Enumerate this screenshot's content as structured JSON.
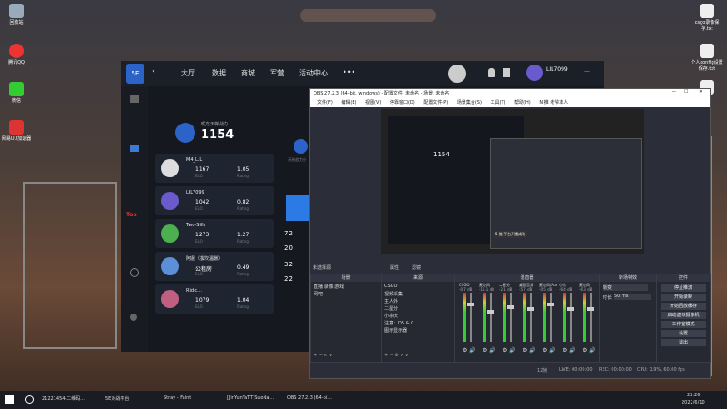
{
  "desktop": {
    "left_icons": [
      {
        "label": "回收站",
        "icon": "recycle-bin-icon",
        "color": "#9ad"
      },
      {
        "label": "腾讯QQ",
        "icon": "qq-icon",
        "color": "#e33"
      },
      {
        "label": "微信",
        "icon": "wechat-icon",
        "color": "#3c3"
      },
      {
        "label": "网易UU加速器",
        "icon": "uu-icon",
        "color": "#d33"
      }
    ],
    "right_icons": [
      {
        "label": "csgo录像保存.txt",
        "icon": "text-file-icon"
      },
      {
        "label": "个人config设置保存.txt",
        "icon": "text-file-icon"
      },
      {
        "label": "",
        "icon": "text-file-icon"
      }
    ]
  },
  "game": {
    "logo": "5E",
    "nav": [
      "大厅",
      "数据",
      "商城",
      "军营",
      "活动中心",
      "•••"
    ],
    "user": "LIL7099",
    "side_label": "Top",
    "highlight": {
      "title": "昵方天梯战力",
      "value": "1154"
    },
    "mid_label": "天梯战力分",
    "players": [
      {
        "name": "M4_L.L",
        "v1": "1167",
        "v2": "1.05",
        "s1": "ELO",
        "s2": "Rating"
      },
      {
        "name": "LIL7099",
        "v1": "1042",
        "v2": "0.82",
        "s1": "ELO",
        "s2": "Rating"
      },
      {
        "name": "Two-Silly",
        "v1": "1273",
        "v2": "1.27",
        "s1": "ELO",
        "s2": "Rating"
      },
      {
        "name": "阿晨（拔坎温酬）",
        "v1": "公租房",
        "v2": "0.49",
        "s1": "ELO",
        "s2": "Rating"
      },
      {
        "name": "Ridic...",
        "v1": "1079",
        "v2": "1.04",
        "s1": "ELO",
        "s2": "Rating"
      }
    ],
    "right_numbers": [
      "72",
      "20",
      "32",
      "22"
    ]
  },
  "obs": {
    "title": "OBS 27.2.3 (64-bit, windows) - 配置文件: 未命名 - 场景: 未命名",
    "menu": [
      "文件(F)",
      "编辑(E)",
      "视图(V)",
      "停靠窗口(D)",
      "配置文件(P)",
      "场景集合(S)",
      "工具(T)",
      "帮助(H)",
      "N 推 老爷本人"
    ],
    "preview_text": "5 推 平台开播成功",
    "preview_score": "1154",
    "no_source": "未选择源",
    "props_btn": "属性",
    "filter_btn": "滤镜",
    "scenes": {
      "header": "场景",
      "items": [
        "直播 录像 游戏",
        "网吧"
      ]
    },
    "sources": {
      "header": "来源",
      "items": [
        "CSGO",
        "视频采集",
        "主人外",
        "二星分",
        "小宗庆",
        "注意：D5 & 0...",
        "图示显示器"
      ]
    },
    "mixer": {
      "header": "混音器",
      "channels": [
        {
          "name": "CSGO",
          "db": "-0.7 dB",
          "level": 0.8
        },
        {
          "name": "麦克风",
          "db": "-15.1 dB",
          "level": 0.65
        },
        {
          "name": "二星分",
          "db": "-2.1 dB",
          "level": 0.75
        },
        {
          "name": "桌面音频",
          "db": "-5.7 dB",
          "level": 0.7
        },
        {
          "name": "麦克风/Aux",
          "db": "-0.5 dB",
          "level": 0.8
        },
        {
          "name": "小宗",
          "db": "-6.4 dB",
          "level": 0.7
        },
        {
          "name": "麦克风",
          "db": "-6.3 dB",
          "level": 0.7
        }
      ]
    },
    "transitions": {
      "header": "转场特效",
      "type": "渐变",
      "duration_label": "时长",
      "duration": "50 ms"
    },
    "controls": {
      "header": "控件",
      "buttons": [
        "停止推流",
        "开始录制",
        "开始回放缓存",
        "启动虚拟摄像机",
        "工作室模式",
        "设置",
        "退出"
      ]
    },
    "status": {
      "dropped": "12帧",
      "live": "LIVE: 00:00:00",
      "rec": "REC: 00:00:00",
      "cpu": "CPU: 1.9%, 60.00 fps"
    }
  },
  "taskbar": {
    "items": [
      "21221454-二维码...",
      "5E对战平台",
      "Stray - Faint",
      "[JinYunYaTT]SuoNa...",
      "OBS 27.2.3 (64-bi..."
    ],
    "time": "22:26",
    "date": "2022/6/10"
  }
}
